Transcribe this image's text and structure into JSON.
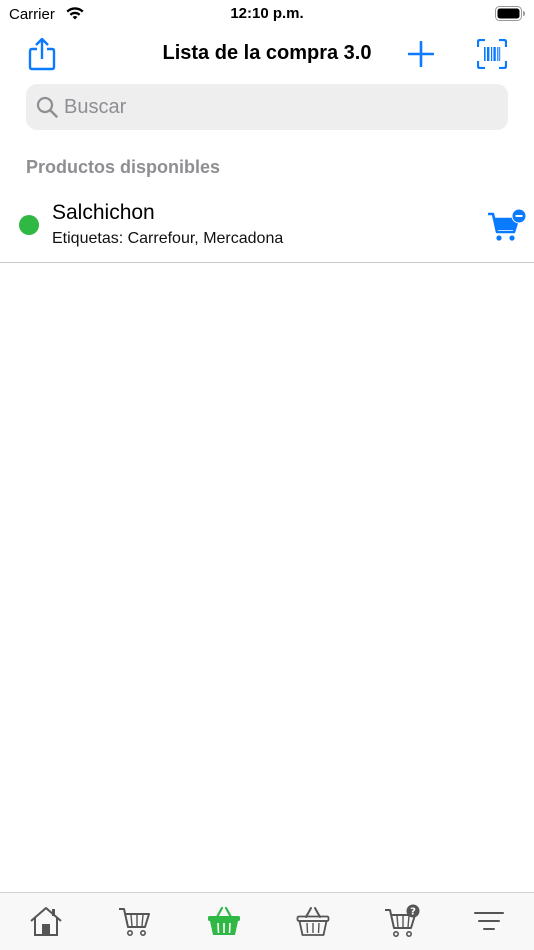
{
  "status_bar": {
    "carrier": "Carrier",
    "time": "12:10 p.m."
  },
  "nav": {
    "title": "Lista de la compra 3.0",
    "share_icon": "share-icon",
    "add_icon": "plus-icon",
    "scan_icon": "barcode-scan-icon"
  },
  "search": {
    "placeholder": "Buscar",
    "value": ""
  },
  "section": {
    "header": "Productos disponibles"
  },
  "items": [
    {
      "title": "Salchichon",
      "tags": "Etiquetas: Carrefour, Mercadona",
      "status_color": "#30b844",
      "action_icon": "cart-remove-icon"
    }
  ],
  "tabs": [
    {
      "icon": "home-icon",
      "active": false
    },
    {
      "icon": "cart-icon",
      "active": false
    },
    {
      "icon": "basket-icon",
      "active": true
    },
    {
      "icon": "basket-icon",
      "active": false
    },
    {
      "icon": "cart-question-icon",
      "active": false
    },
    {
      "icon": "menu-icon",
      "active": false
    }
  ],
  "colors": {
    "accent": "#0a7aff",
    "active_tab": "#30b844",
    "inactive_tab": "#555555"
  }
}
